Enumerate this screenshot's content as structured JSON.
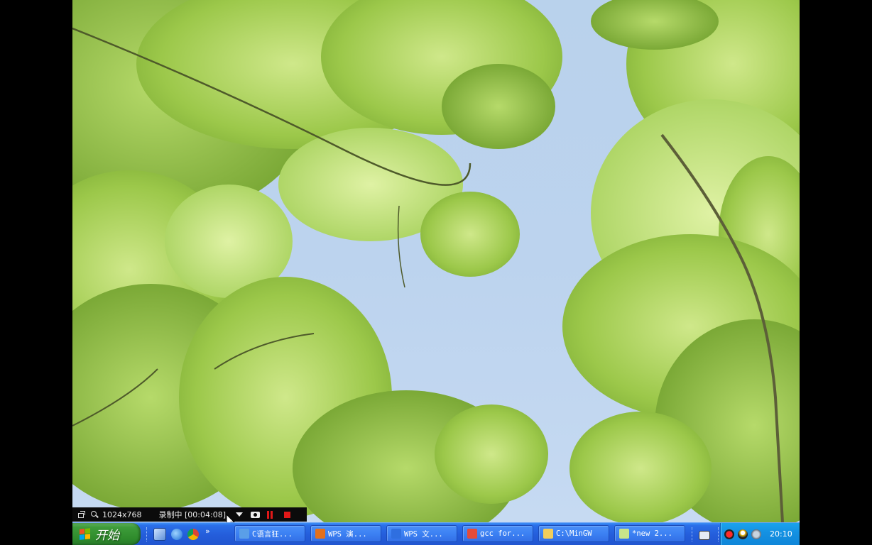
{
  "recorder": {
    "resolution": "1024x768",
    "status": "录制中 [00:04:08]"
  },
  "taskbar": {
    "start_label": "开始",
    "quicklaunch_overflow": "»",
    "tasks": [
      {
        "label": "C语言狂...",
        "icon": "c-language-app-icon",
        "color": "#5a9fe8"
      },
      {
        "label": "WPS 演...",
        "icon": "wps-presentation-icon",
        "color": "#e2701c"
      },
      {
        "label": "WPS 文...",
        "icon": "wps-writer-icon",
        "color": "#2f6fe0"
      },
      {
        "label": "gcc for...",
        "icon": "chrome-icon",
        "color": "#e44b3a"
      },
      {
        "label": "C:\\MinGW",
        "icon": "folder-icon",
        "color": "#f2cd5a"
      },
      {
        "label": "*new  2...",
        "icon": "notepad-icon",
        "color": "#c9e48a"
      }
    ],
    "clock": "20:10"
  },
  "colors": {
    "taskbar_blue": "#245ddb",
    "start_green": "#3d9b3a",
    "tray_blue": "#1592e3",
    "recorder_red": "#e01818"
  }
}
